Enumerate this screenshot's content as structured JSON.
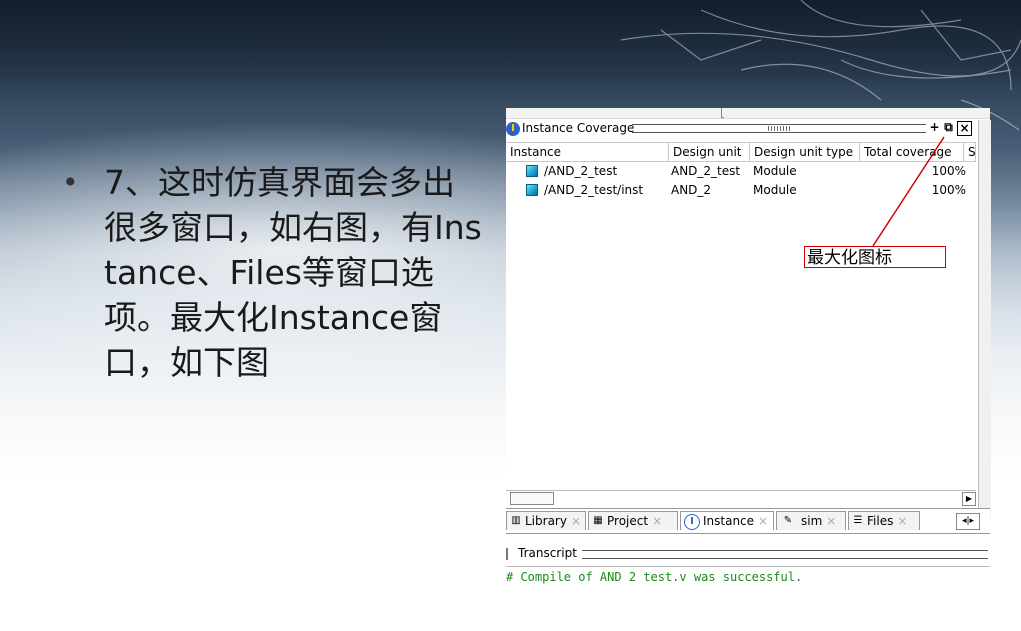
{
  "slide": {
    "bullet_symbol": "•",
    "bullet_text": "7、这时仿真界面会多出很多窗口，如右图，有Instance、Files等窗口选项。最大化Instance窗口，如下图"
  },
  "window": {
    "title": "Instance Coverage",
    "title_icon": "instance-coverage-icon",
    "buttons": {
      "dock": "+",
      "maximize": "⧉",
      "close": "×"
    },
    "columns": [
      "Instance",
      "Design unit",
      "Design unit type",
      "Total coverage",
      "S"
    ],
    "rows": [
      {
        "instance": "/AND_2_test",
        "design_unit": "AND_2_test",
        "design_unit_type": "Module",
        "total_coverage": "100%"
      },
      {
        "instance": "/AND_2_test/inst",
        "design_unit": "AND_2",
        "design_unit_type": "Module",
        "total_coverage": "100%"
      }
    ],
    "tabs": [
      {
        "label": "Library",
        "icon": "library-icon",
        "close": "×"
      },
      {
        "label": "Project",
        "icon": "project-icon",
        "close": "×"
      },
      {
        "label": "Instance",
        "icon": "instance-icon",
        "close": "×",
        "active": true
      },
      {
        "label": "sim",
        "icon": "sim-icon",
        "close": "×"
      },
      {
        "label": "Files",
        "icon": "files-icon",
        "close": "×"
      }
    ],
    "tab_nav": "◂|▸",
    "transcript_title": "Transcript",
    "console_line": "# Compile of AND 2 test.v was successful."
  },
  "annotation": {
    "label": "最大化图标",
    "color": "#d20000"
  }
}
